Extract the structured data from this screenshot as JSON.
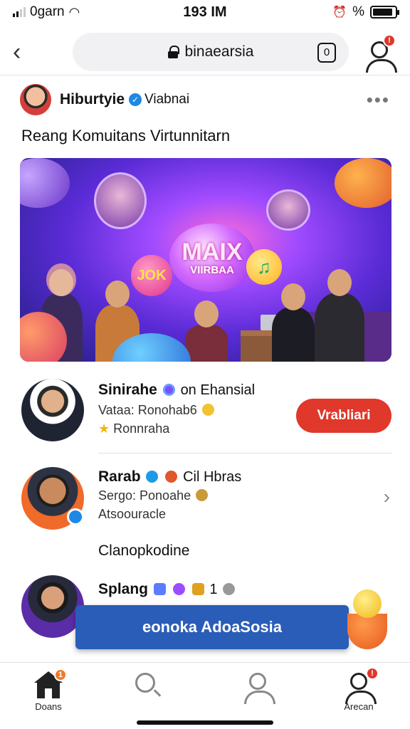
{
  "status_bar": {
    "carrier": "0garn",
    "time": "193 IM",
    "battery_text": "%",
    "battery_level": 0.9
  },
  "browser": {
    "url": "binaearsia",
    "tabs_count": "0",
    "profile_badge": "!"
  },
  "post": {
    "author": "Hiburtyie",
    "author_sub": "Viabnai",
    "more_label": "•••",
    "text": "Reang Komuitans Virtunnitarn",
    "image": {
      "center_big": "MAIX",
      "center_small": "VIIRBAA",
      "tag_text": "JOK",
      "note_icon": "music-note-icon"
    }
  },
  "list": [
    {
      "name": "Sinirahe",
      "name_extra": "on Ehansial",
      "line1": "Vataa: Ronohab6",
      "line2": "Ronnraha",
      "action_label": "Vrabliari"
    },
    {
      "name": "Rarab",
      "name_extra": "Cil Hbras",
      "line1": "Sergo: Ponoahe",
      "line2": "Atsoouracle"
    },
    {
      "name": "Splang",
      "name_extra": "1",
      "line1": "",
      "line2": ""
    }
  ],
  "section_label": "Clanopkodine",
  "toast": {
    "text": "eonoka AdoaSosia"
  },
  "bottom_nav": [
    {
      "label": "Doans",
      "icon": "home-icon",
      "badge": "1"
    },
    {
      "label": "",
      "icon": "search-icon"
    },
    {
      "label": "",
      "icon": "people-icon"
    },
    {
      "label": "Arecan",
      "icon": "profile-icon",
      "badge": "!"
    }
  ],
  "colors": {
    "accent_red": "#e0382b",
    "toast_blue": "#2a5db8",
    "verified_blue": "#1e88e5"
  }
}
